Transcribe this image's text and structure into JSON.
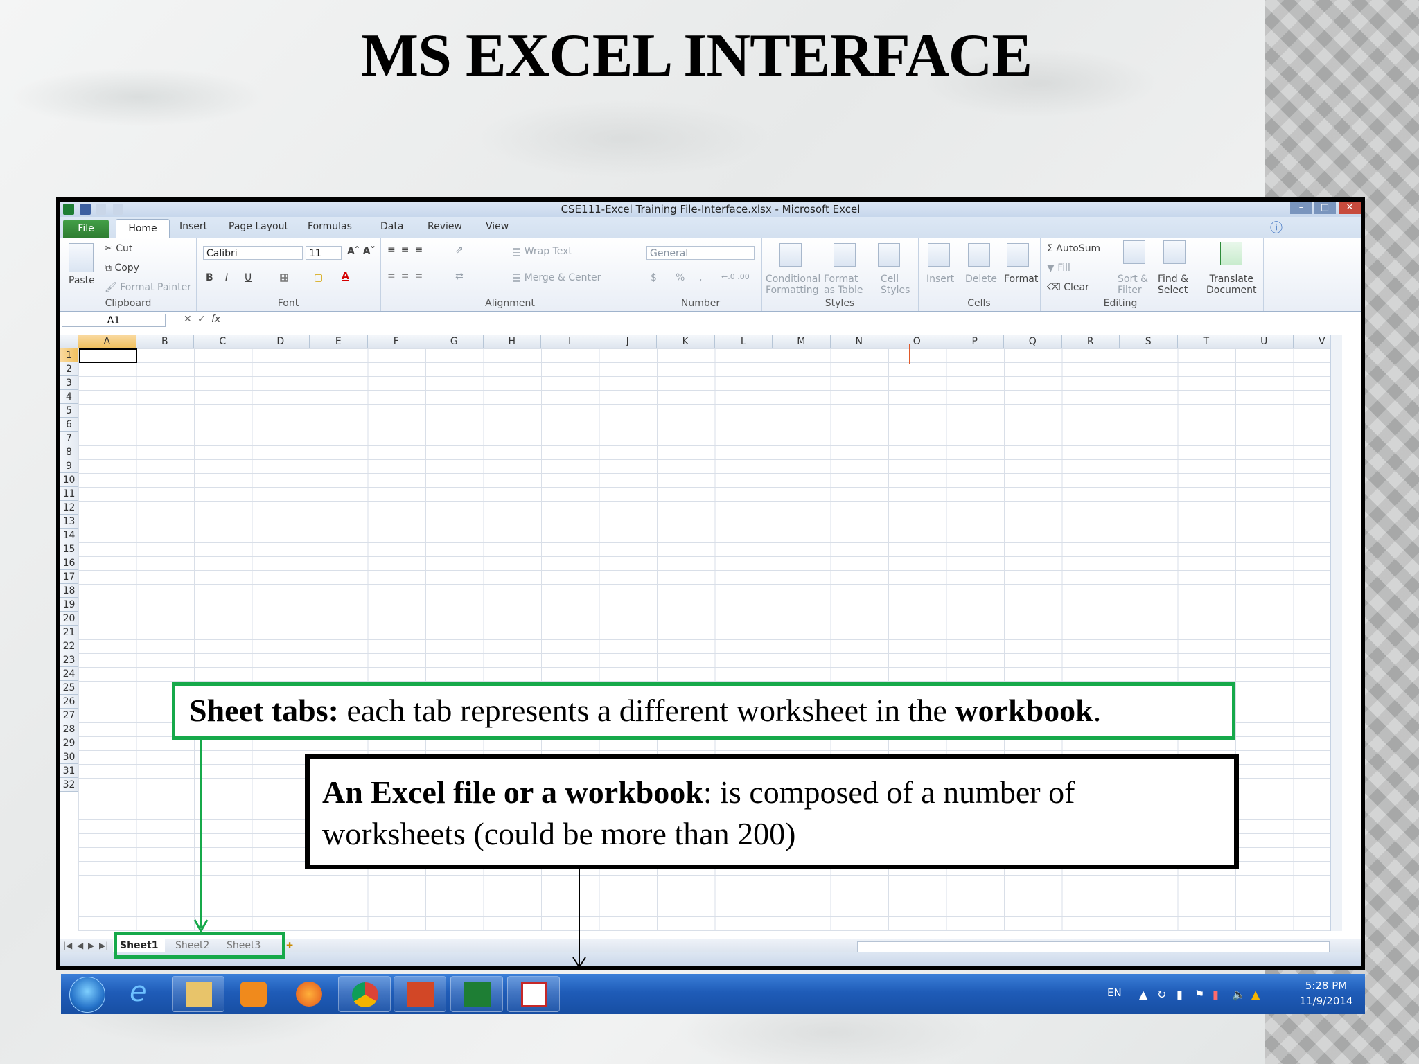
{
  "slide": {
    "title": "MS EXCEL INTERFACE"
  },
  "window": {
    "title": "CSE111-Excel Training File-Interface.xlsx  -  Microsoft Excel"
  },
  "tabs": [
    "File",
    "Home",
    "Insert",
    "Page Layout",
    "Formulas",
    "Data",
    "Review",
    "View"
  ],
  "ribbon": {
    "clipboard": {
      "label": "Clipboard",
      "paste": "Paste",
      "cut": "Cut",
      "copy": "Copy",
      "format_painter": "Format Painter"
    },
    "font": {
      "label": "Font",
      "font_name": "Calibri",
      "font_size": "11",
      "bold": "B",
      "italic": "I",
      "underline": "U"
    },
    "alignment": {
      "label": "Alignment",
      "wrap_text": "Wrap Text",
      "merge_center": "Merge & Center"
    },
    "number": {
      "label": "Number",
      "format": "General",
      "currency": "$",
      "percent": "%",
      "comma": ","
    },
    "styles": {
      "label": "Styles",
      "conditional_1": "Conditional",
      "conditional_2": "Formatting",
      "format_table_1": "Format",
      "format_table_2": "as Table",
      "cell_styles_1": "Cell",
      "cell_styles_2": "Styles"
    },
    "cells": {
      "label": "Cells",
      "insert": "Insert",
      "delete": "Delete",
      "format": "Format"
    },
    "editing": {
      "label": "Editing",
      "autosum": "AutoSum",
      "fill": "Fill",
      "clear": "Clear",
      "sort_1": "Sort &",
      "sort_2": "Filter",
      "find_1": "Find &",
      "find_2": "Select"
    },
    "translate": {
      "line1": "Translate",
      "line2": "Document"
    }
  },
  "formula_bar": {
    "name_box": "A1",
    "fx": "fx"
  },
  "grid": {
    "columns": [
      "A",
      "B",
      "C",
      "D",
      "E",
      "F",
      "G",
      "H",
      "I",
      "J",
      "K",
      "L",
      "M",
      "N",
      "O",
      "P",
      "Q",
      "R",
      "S",
      "T",
      "U",
      "V"
    ],
    "rows": [
      "1",
      "2",
      "3",
      "4",
      "5",
      "6",
      "7",
      "8",
      "9",
      "10",
      "11",
      "12",
      "13",
      "14",
      "15",
      "16",
      "17",
      "18",
      "19",
      "20",
      "21",
      "22",
      "23",
      "24",
      "25",
      "26",
      "27",
      "28",
      "29",
      "30",
      "31",
      "32"
    ],
    "active_cell": "A1"
  },
  "sheets": [
    "Sheet1",
    "Sheet2",
    "Sheet3"
  ],
  "taskbar": {
    "language": "EN",
    "time": "5:28 PM",
    "date": "11/9/2014"
  },
  "annotations": {
    "sheet_tabs": {
      "bold": "Sheet tabs:",
      "text": " each tab represents a different worksheet in the ",
      "bold2": "workbook",
      "end": "."
    },
    "workbook": {
      "bold": "An Excel file or a workbook",
      "text": ": is composed of a number of worksheets (could be more than 200)"
    }
  },
  "colors": {
    "callout_green": "#16a94a",
    "file_tab": "#2e7d32",
    "taskbar": "#1f5cb8"
  }
}
